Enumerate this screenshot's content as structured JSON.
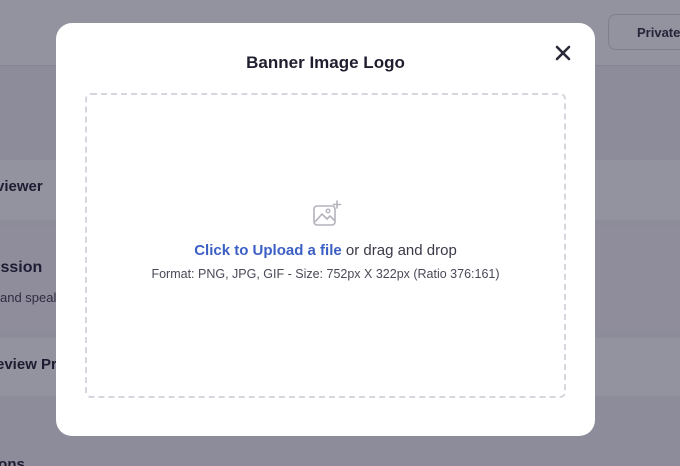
{
  "background": {
    "private_label": "Private",
    "items": [
      {
        "label": "viewer"
      },
      {
        "label": "ission",
        "sub": "and speal"
      },
      {
        "label": "eview Pr"
      },
      {
        "label": "ions"
      }
    ]
  },
  "modal": {
    "title": "Banner Image Logo",
    "close_icon": "close-icon",
    "dropzone": {
      "icon": "image-add-icon",
      "upload_link": "Click to Upload a file",
      "upload_rest": " or drag and drop",
      "format_text": "Format: PNG, JPG, GIF - Size: 752px X 322px (Ratio 376:161)"
    }
  },
  "colors": {
    "link": "#3b5fc4",
    "overlay": "rgba(30, 27, 55, 0.48)",
    "modal_bg": "#ffffff"
  }
}
